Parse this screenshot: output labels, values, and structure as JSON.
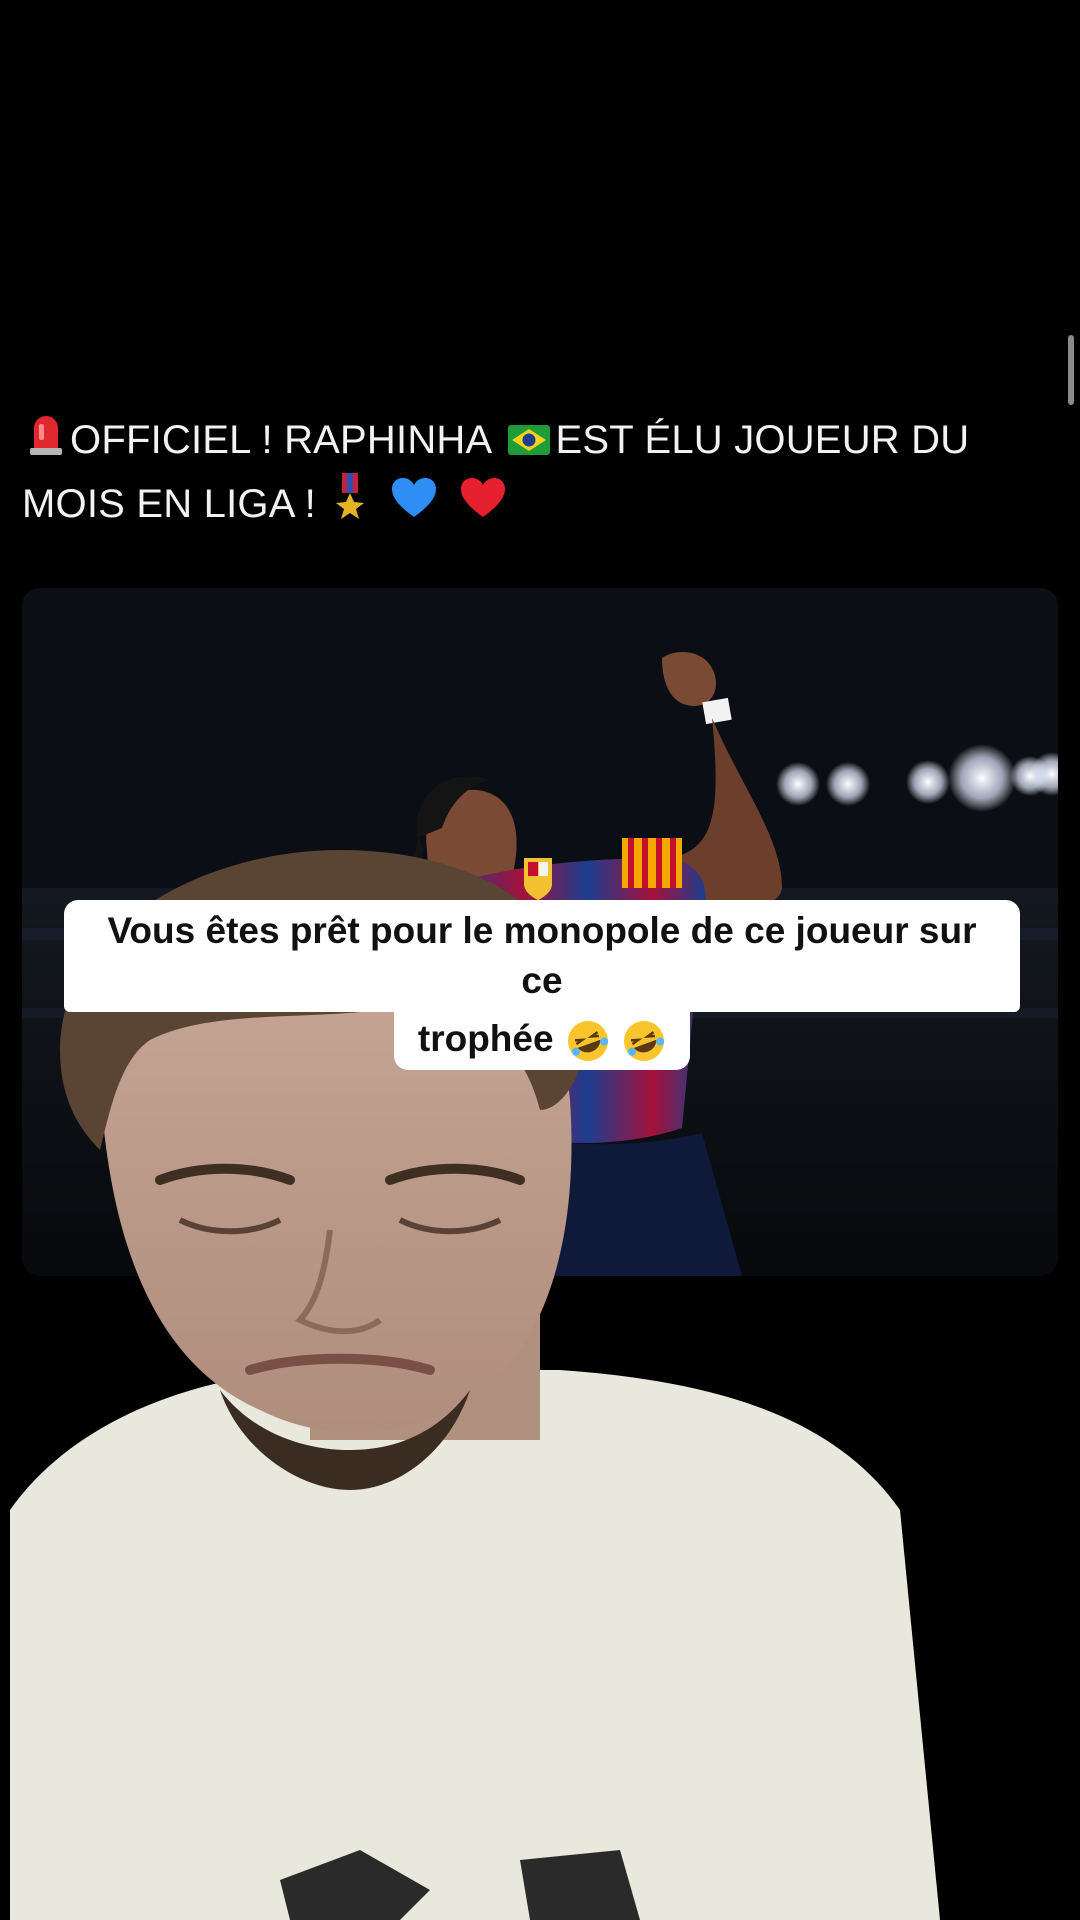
{
  "post": {
    "title_part1": "OFFICIEL ! RAPHINHA",
    "title_part2": "EST ÉLU JOUEUR DU",
    "title_part3": "MOIS EN LIGA !",
    "emoji_icons": [
      "siren-icon",
      "brazil-flag-icon",
      "military-medal-icon",
      "blue-heart-icon",
      "red-heart-icon"
    ]
  },
  "caption": {
    "line1": "Vous êtes prêt pour le monopole de ce joueur sur ce",
    "line2": "trophée",
    "line2_emojis": [
      "rolling-laughing-icon",
      "rolling-laughing-icon"
    ]
  },
  "colors": {
    "background": "#000000",
    "title_text": "#f2f2f2",
    "caption_bg": "#ffffff",
    "caption_text": "#111111",
    "barca_blue": "#1d3d8f",
    "barca_red": "#a3123a"
  }
}
